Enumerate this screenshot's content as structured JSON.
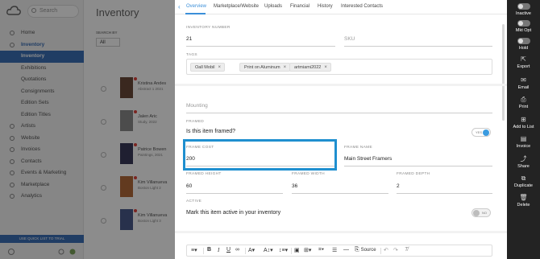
{
  "background": {
    "search_placeholder": "Search",
    "page_title": "Inventory",
    "filter": {
      "label": "SEARCH BY",
      "value": "All"
    },
    "nav": [
      {
        "label": "Home",
        "kind": "item"
      },
      {
        "label": "Inventory",
        "kind": "bold"
      },
      {
        "label": "Inventory",
        "kind": "sel"
      },
      {
        "label": "Exhibitions",
        "kind": "sub"
      },
      {
        "label": "Quotations",
        "kind": "sub"
      },
      {
        "label": "Consignments",
        "kind": "sub"
      },
      {
        "label": "Edition Sets",
        "kind": "sub"
      },
      {
        "label": "Edition Titles",
        "kind": "sub"
      },
      {
        "label": "Artists",
        "kind": "item"
      },
      {
        "label": "Website",
        "kind": "item"
      },
      {
        "label": "Invoices",
        "kind": "item"
      },
      {
        "label": "Contacts",
        "kind": "item"
      },
      {
        "label": "Events & Marketing",
        "kind": "item"
      },
      {
        "label": "Marketplace",
        "kind": "item"
      },
      {
        "label": "Analytics",
        "kind": "item"
      }
    ],
    "trial_text": "USE QUICK LIST TO TRIAL",
    "rows": [
      {
        "title": "Kristina Andes",
        "sub": "Abstract 1 2021"
      },
      {
        "title": "Jalen Aric",
        "sub": "Study, 2022"
      },
      {
        "title": "Patrice Bowen",
        "sub": "Paintings, 2021"
      },
      {
        "title": "Kim Villanueva",
        "sub": "Boston Light 2"
      },
      {
        "title": "Kim Villanueva",
        "sub": "Boston Light 3"
      }
    ]
  },
  "panel": {
    "tabs": [
      {
        "label": "Overview",
        "active": true
      },
      {
        "label": "Marketplace/Website",
        "active": false
      },
      {
        "label": "Uploads",
        "active": false
      },
      {
        "label": "Financial",
        "active": false
      },
      {
        "label": "History",
        "active": false
      },
      {
        "label": "Interested Contacts",
        "active": false
      }
    ],
    "inventory_number": {
      "label": "INVENTORY NUMBER",
      "value": "21"
    },
    "sku": {
      "placeholder": "SKU"
    },
    "tags": {
      "label": "TAGS",
      "items": [
        "Oall Mobil",
        "Print on Aluminum",
        "artmiami2022"
      ],
      "remove_glyph": "×"
    },
    "mounting": {
      "placeholder": "Mounting"
    },
    "framed": {
      "label": "FRAMED",
      "question": "Is this item framed?",
      "toggle_text": "YES",
      "on": true
    },
    "frame_cost": {
      "label": "FRAME COST",
      "value": "200"
    },
    "frame_name": {
      "label": "FRAME NAME",
      "value": "Main Street Framers"
    },
    "framed_height": {
      "label": "FRAMED HEIGHT",
      "value": "60"
    },
    "framed_width": {
      "label": "FRAMED WIDTH",
      "value": "36"
    },
    "framed_depth": {
      "label": "FRAMED DEPTH",
      "value": "2"
    },
    "active": {
      "label": "ACTIVE",
      "question": "Mark this item active in your inventory",
      "toggle_text": "NO",
      "on": false
    },
    "editor": {
      "source_label": "Source"
    },
    "highlight_color": "#1f8fcf",
    "accent_color": "#3b8fd9"
  },
  "actions": [
    {
      "label": "Inactive",
      "icon": "toggle-icon"
    },
    {
      "label": "Mkt Opt",
      "icon": "toggle-icon"
    },
    {
      "label": "Hold",
      "icon": "toggle-icon"
    },
    {
      "label": "Export",
      "icon": "export-icon",
      "glyph": "⇱"
    },
    {
      "label": "Email",
      "icon": "email-icon",
      "glyph": "✉"
    },
    {
      "label": "Print",
      "icon": "print-icon",
      "glyph": "⎙"
    },
    {
      "label": "Add to List",
      "icon": "add-to-list-icon",
      "glyph": "⊞"
    },
    {
      "label": "Invoice",
      "icon": "invoice-icon",
      "glyph": "▤"
    },
    {
      "label": "Share",
      "icon": "share-icon",
      "glyph": "⤴"
    },
    {
      "label": "Duplicate",
      "icon": "duplicate-icon",
      "glyph": "⧉"
    },
    {
      "label": "Delete",
      "icon": "delete-icon",
      "glyph": "🗑"
    }
  ]
}
